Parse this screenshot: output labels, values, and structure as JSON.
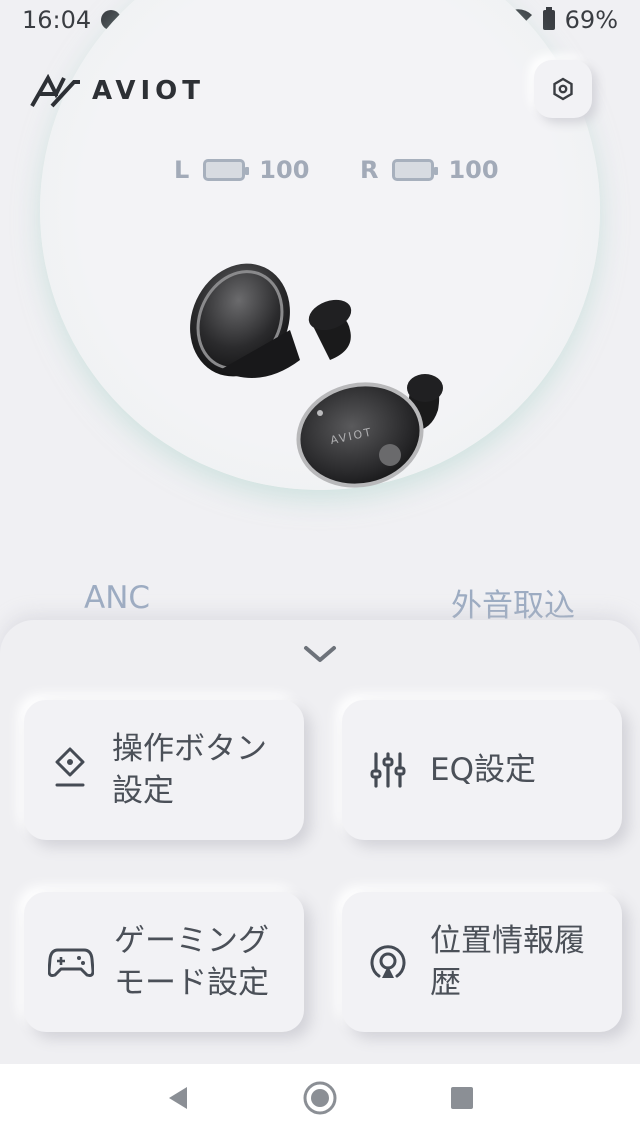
{
  "status_bar": {
    "time": "16:04",
    "battery_percent": "69%",
    "icons": [
      "notification-dot-icon",
      "battery-saver-icon",
      "bluetooth-icon",
      "vibrate-icon",
      "wifi-icon",
      "battery-icon"
    ]
  },
  "header": {
    "logo_text": "AVIOT",
    "settings_icon": "gear-icon"
  },
  "device": {
    "left_label": "L",
    "left_battery": "100",
    "right_label": "R",
    "right_battery": "100",
    "earbud_brand": "AVIOT"
  },
  "modes": {
    "left": "ANC",
    "right": "外音取込"
  },
  "menu": {
    "expand_icon": "chevron-down-icon",
    "cards": [
      {
        "label_line1": "操作ボタン",
        "label_line2": "設定",
        "icon": "touch-control-icon"
      },
      {
        "label_line1": "EQ設定",
        "label_line2": "",
        "icon": "equalizer-icon"
      },
      {
        "label_line1": "ゲーミング",
        "label_line2": "モード設定",
        "icon": "gamepad-icon"
      },
      {
        "label_line1": "位置情報履",
        "label_line2": "歴",
        "icon": "location-history-icon"
      }
    ]
  },
  "navbar": {
    "icons": [
      "back-icon",
      "home-icon",
      "recents-icon"
    ]
  },
  "colors": {
    "background": "#f0f0f3",
    "accent_glow": "#cfe8e2",
    "muted_blue": "#9dacc2",
    "text_dark": "#4b5058"
  }
}
